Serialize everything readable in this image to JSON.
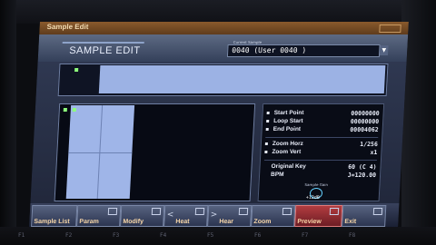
{
  "window": {
    "title": "Sample Edit"
  },
  "header": {
    "mode_title": "SAMPLE EDIT",
    "current_sample_label": "Current Sample",
    "current_sample_value": "0040 (User 0040          )"
  },
  "params": [
    {
      "label": "Start Point",
      "value": "00000000"
    },
    {
      "label": "Loop Start",
      "value": "00000000"
    },
    {
      "label": "End Point",
      "value": "00004062"
    },
    {
      "label": "Zoom Horz",
      "value": "1/256"
    },
    {
      "label": "Zoom Vert",
      "value": "x1"
    },
    {
      "label": "Original Key",
      "value": "60 (C 4)"
    },
    {
      "label": "BPM",
      "value": "J=120.00"
    }
  ],
  "sample_gain": {
    "label": "Sample Gain",
    "value": "+12dB"
  },
  "function_buttons": [
    {
      "label": "Sample List"
    },
    {
      "label": "Param"
    },
    {
      "label": "Modify"
    },
    {
      "label": "Heat"
    },
    {
      "label": "Hear"
    },
    {
      "label": "Zoom"
    },
    {
      "label": "Preview"
    },
    {
      "label": "Exit"
    }
  ],
  "fkeys": [
    "F1",
    "F2",
    "F3",
    "F4",
    "F5",
    "F6",
    "F7",
    "F8"
  ]
}
